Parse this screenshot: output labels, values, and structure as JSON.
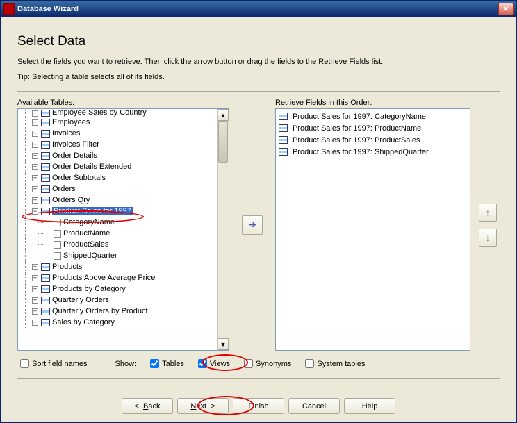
{
  "window": {
    "title": "Database Wizard"
  },
  "page": {
    "heading": "Select Data",
    "instruction": "Select the fields you want to retrieve. Then click the arrow button or drag the fields to the Retrieve Fields list.",
    "tip": "Tip: Selecting a table selects all of its fields."
  },
  "left": {
    "label": "Available Tables:",
    "tree_top_cut": "Employee Sales by Country",
    "nodes": [
      "Employees",
      "Invoices",
      "Invoices Filter",
      "Order Details",
      "Order Details Extended",
      "Order Subtotals",
      "Orders",
      "Orders Qry"
    ],
    "selected_node": "Product Sales for 1997",
    "selected_children": [
      "CategoryName",
      "ProductName",
      "ProductSales",
      "ShippedQuarter"
    ],
    "nodes_after": [
      "Products",
      "Products Above Average Price",
      "Products by Category",
      "Quarterly Orders",
      "Quarterly Orders by Product",
      "Sales by Category"
    ]
  },
  "right": {
    "label": "Retrieve Fields in this Order:",
    "items": [
      "Product Sales for 1997: CategoryName",
      "Product Sales for 1997: ProductName",
      "Product Sales for 1997: ProductSales",
      "Product Sales for 1997: ShippedQuarter"
    ]
  },
  "options": {
    "sort_label_pre": "S",
    "sort_label_rest": "ort field names",
    "show_label": "Show:",
    "tables_pre": "T",
    "tables_rest": "ables",
    "views_pre": "V",
    "views_rest": "iews",
    "synonyms_label": "Synonyms",
    "system_pre": "S",
    "system_rest": "ystem tables",
    "sort_checked": false,
    "tables_checked": true,
    "views_checked": true,
    "synonyms_checked": false,
    "system_checked": false
  },
  "buttons": {
    "back_pre": "B",
    "back_rest": "ack",
    "next_pre": "N",
    "next_rest": "ext",
    "finish": "Finish",
    "cancel": "Cancel",
    "help": "Help"
  }
}
